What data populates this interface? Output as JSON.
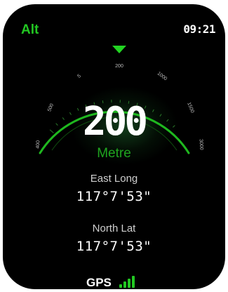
{
  "header": {
    "title": "Alt",
    "time": "09:21"
  },
  "gauge": {
    "marker": "triangle-marker-icon",
    "ticks": [
      "200",
      "1000",
      "1500",
      "3000",
      "5",
      "500",
      "400"
    ],
    "accent": "#22c722"
  },
  "altitude": {
    "value": "200",
    "unit": "Metre"
  },
  "coords": {
    "east_label": "East Long",
    "east_value": "117°7'53\"",
    "north_label": "North Lat",
    "north_value": "117°7'53\""
  },
  "gps": {
    "label": "GPS",
    "icon": "signal-bars-icon",
    "bars": 4
  }
}
